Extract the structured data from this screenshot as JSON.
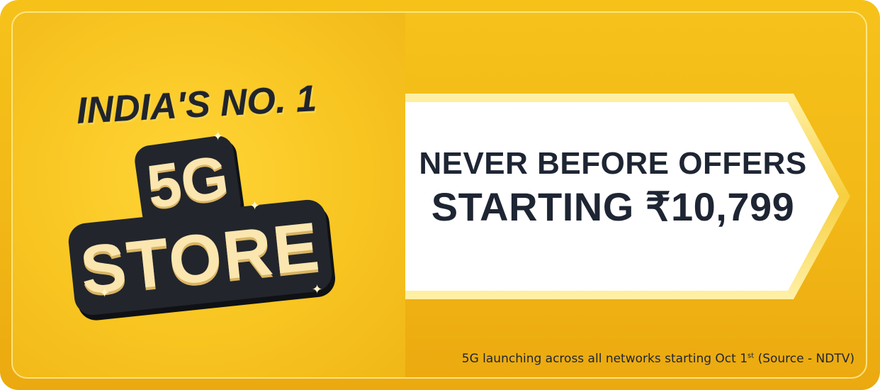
{
  "promo": {
    "tagline": "INDIA'S NO. 1",
    "badge_top": "5G",
    "badge_bottom": "STORE"
  },
  "offer": {
    "line1": "NEVER BEFORE OFFERS",
    "line2": "STARTING ₹10,799"
  },
  "footnote": {
    "text_before": "5G launching across all networks starting Oct 1",
    "superscript": "st",
    "text_after": " (Source - NDTV)"
  },
  "colors": {
    "background_gold": "#f2b817",
    "dark_navy": "#1e2533",
    "badge_dark": "#22252b",
    "badge_text_cream": "#fbe6b0",
    "arrow_fill": "#ffffff"
  },
  "icons": [
    "sparkle-icon"
  ]
}
